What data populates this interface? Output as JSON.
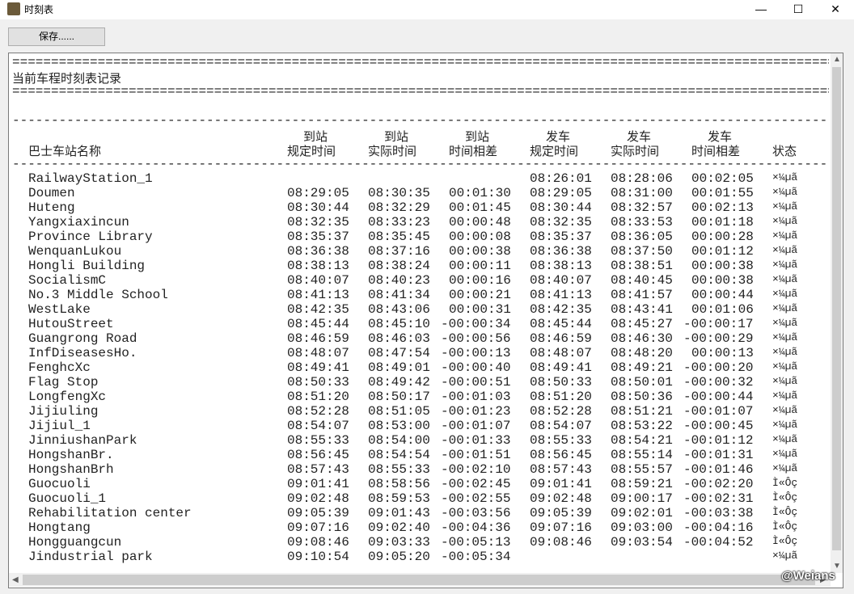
{
  "window": {
    "title": "时刻表",
    "minimize": "—",
    "maximize": "☐",
    "close": "✕"
  },
  "toolbar": {
    "save_label": "保存......"
  },
  "report": {
    "title": "当前车程时刻表记录",
    "double_rule": "==================================================================================================================================",
    "single_rule": "----------------------------------------------------------------------------------------------------------------------------------",
    "headers": {
      "name": "巴士车站名称",
      "arr_sched": [
        "到站",
        "规定时间"
      ],
      "arr_actual": [
        "到站",
        "实际时间"
      ],
      "arr_diff": [
        "到站",
        "时间相差"
      ],
      "dep_sched": [
        "发车",
        "规定时间"
      ],
      "dep_actual": [
        "发车",
        "实际时间"
      ],
      "dep_diff": [
        "发车",
        "时间相差"
      ],
      "status": "状态"
    },
    "rows": [
      [
        "RailwayStation_1",
        "",
        "",
        "",
        "08:26:01",
        "08:28:06",
        "00:02:05",
        "×¼µã"
      ],
      [
        "Doumen",
        "08:29:05",
        "08:30:35",
        "00:01:30",
        "08:29:05",
        "08:31:00",
        "00:01:55",
        "×¼µã"
      ],
      [
        "Huteng",
        "08:30:44",
        "08:32:29",
        "00:01:45",
        "08:30:44",
        "08:32:57",
        "00:02:13",
        "×¼µã"
      ],
      [
        "Yangxiaxincun",
        "08:32:35",
        "08:33:23",
        "00:00:48",
        "08:32:35",
        "08:33:53",
        "00:01:18",
        "×¼µã"
      ],
      [
        "Province Library",
        "08:35:37",
        "08:35:45",
        "00:00:08",
        "08:35:37",
        "08:36:05",
        "00:00:28",
        "×¼µã"
      ],
      [
        "WenquanLukou",
        "08:36:38",
        "08:37:16",
        "00:00:38",
        "08:36:38",
        "08:37:50",
        "00:01:12",
        "×¼µã"
      ],
      [
        "Hongli Building",
        "08:38:13",
        "08:38:24",
        "00:00:11",
        "08:38:13",
        "08:38:51",
        "00:00:38",
        "×¼µã"
      ],
      [
        "SocialismC",
        "08:40:07",
        "08:40:23",
        "00:00:16",
        "08:40:07",
        "08:40:45",
        "00:00:38",
        "×¼µã"
      ],
      [
        "No.3 Middle School",
        "08:41:13",
        "08:41:34",
        "00:00:21",
        "08:41:13",
        "08:41:57",
        "00:00:44",
        "×¼µã"
      ],
      [
        "WestLake",
        "08:42:35",
        "08:43:06",
        "00:00:31",
        "08:42:35",
        "08:43:41",
        "00:01:06",
        "×¼µã"
      ],
      [
        "HutouStreet",
        "08:45:44",
        "08:45:10",
        "-00:00:34",
        "08:45:44",
        "08:45:27",
        "-00:00:17",
        "×¼µã"
      ],
      [
        "Guangrong Road",
        "08:46:59",
        "08:46:03",
        "-00:00:56",
        "08:46:59",
        "08:46:30",
        "-00:00:29",
        "×¼µã"
      ],
      [
        "InfDiseasesHo.",
        "08:48:07",
        "08:47:54",
        "-00:00:13",
        "08:48:07",
        "08:48:20",
        "00:00:13",
        "×¼µã"
      ],
      [
        "FenghcXc",
        "08:49:41",
        "08:49:01",
        "-00:00:40",
        "08:49:41",
        "08:49:21",
        "-00:00:20",
        "×¼µã"
      ],
      [
        "Flag Stop",
        "08:50:33",
        "08:49:42",
        "-00:00:51",
        "08:50:33",
        "08:50:01",
        "-00:00:32",
        "×¼µã"
      ],
      [
        "LongfengXc",
        "08:51:20",
        "08:50:17",
        "-00:01:03",
        "08:51:20",
        "08:50:36",
        "-00:00:44",
        "×¼µã"
      ],
      [
        "Jijiuling",
        "08:52:28",
        "08:51:05",
        "-00:01:23",
        "08:52:28",
        "08:51:21",
        "-00:01:07",
        "×¼µã"
      ],
      [
        "Jijiul_1",
        "08:54:07",
        "08:53:00",
        "-00:01:07",
        "08:54:07",
        "08:53:22",
        "-00:00:45",
        "×¼µã"
      ],
      [
        "JinniushanPark",
        "08:55:33",
        "08:54:00",
        "-00:01:33",
        "08:55:33",
        "08:54:21",
        "-00:01:12",
        "×¼µã"
      ],
      [
        "HongshanBr.",
        "08:56:45",
        "08:54:54",
        "-00:01:51",
        "08:56:45",
        "08:55:14",
        "-00:01:31",
        "×¼µã"
      ],
      [
        "HongshanBrh",
        "08:57:43",
        "08:55:33",
        "-00:02:10",
        "08:57:43",
        "08:55:57",
        "-00:01:46",
        "×¼µã"
      ],
      [
        "Guocuoli",
        "09:01:41",
        "08:58:56",
        "-00:02:45",
        "09:01:41",
        "08:59:21",
        "-00:02:20",
        "Ì«Ôç"
      ],
      [
        "Guocuoli_1",
        "09:02:48",
        "08:59:53",
        "-00:02:55",
        "09:02:48",
        "09:00:17",
        "-00:02:31",
        "Ì«Ôç"
      ],
      [
        "Rehabilitation center",
        "09:05:39",
        "09:01:43",
        "-00:03:56",
        "09:05:39",
        "09:02:01",
        "-00:03:38",
        "Ì«Ôç"
      ],
      [
        "Hongtang",
        "09:07:16",
        "09:02:40",
        "-00:04:36",
        "09:07:16",
        "09:03:00",
        "-00:04:16",
        "Ì«Ôç"
      ],
      [
        "Hongguangcun",
        "09:08:46",
        "09:03:33",
        "-00:05:13",
        "09:08:46",
        "09:03:54",
        "-00:04:52",
        "Ì«Ôç"
      ],
      [
        "Jindustrial park",
        "09:10:54",
        "09:05:20",
        "-00:05:34",
        "",
        "",
        "",
        "×¼µã"
      ]
    ]
  },
  "watermark": "@Weians"
}
